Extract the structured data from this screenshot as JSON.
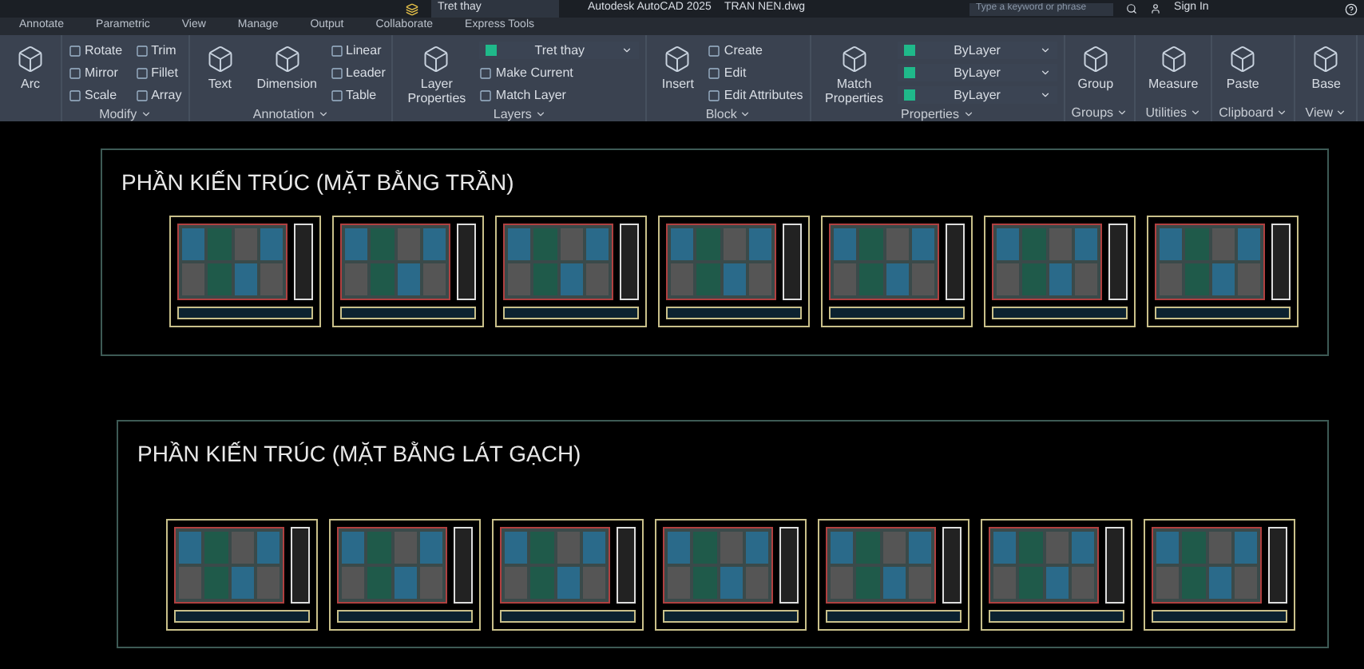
{
  "title_bar": {
    "layer": "Tret thay",
    "app_title": "Autodesk AutoCAD 2025",
    "file_name": "TRAN NEN.dwg",
    "search": {
      "placeholder": "Type a keyword or phrase"
    },
    "sign_in": "Sign In"
  },
  "ribbon_tabs": [
    {
      "label": "Annotate",
      "selected": false
    },
    {
      "label": "Parametric",
      "selected": false
    },
    {
      "label": "View",
      "selected": false
    },
    {
      "label": "Manage",
      "selected": false
    },
    {
      "label": "Output",
      "selected": false
    },
    {
      "label": "Collaborate",
      "selected": false
    },
    {
      "label": "Express Tools",
      "selected": false
    }
  ],
  "panels": [
    {
      "tools": [
        {
          "kind": "large",
          "label": "Arc"
        }
      ]
    },
    {
      "title": "Modify",
      "tools": [
        {
          "kind": "small",
          "label": "Rotate"
        },
        {
          "kind": "small",
          "label": "Mirror"
        },
        {
          "kind": "small",
          "label": "Scale"
        },
        {
          "kind": "small",
          "label": "Trim"
        },
        {
          "kind": "small",
          "label": "Fillet"
        },
        {
          "kind": "small",
          "label": "Array"
        }
      ]
    },
    {
      "title": "Annotation",
      "tools": [
        {
          "kind": "large",
          "label": "Text"
        },
        {
          "kind": "large",
          "label": "Dimension"
        },
        {
          "kind": "small",
          "label": "Linear"
        },
        {
          "kind": "small",
          "label": "Leader"
        },
        {
          "kind": "small",
          "label": "Table"
        }
      ]
    },
    {
      "title": "Layers",
      "tools": [
        {
          "kind": "large",
          "label": "Layer Properties"
        },
        {
          "kind": "dropdown",
          "label": "Tret thay"
        },
        {
          "kind": "small",
          "label": "Make Current"
        },
        {
          "kind": "small",
          "label": "Match Layer"
        }
      ]
    },
    {
      "title": "Block",
      "tools": [
        {
          "kind": "large",
          "label": "Insert"
        },
        {
          "kind": "small",
          "label": "Create"
        },
        {
          "kind": "small",
          "label": "Edit"
        },
        {
          "kind": "small",
          "label": "Edit Attributes"
        }
      ]
    },
    {
      "title": "Properties",
      "tools": [
        {
          "kind": "large",
          "label": "Match Properties"
        },
        {
          "kind": "dropdown",
          "label": "ByLayer"
        },
        {
          "kind": "dropdown",
          "label": "ByLayer"
        },
        {
          "kind": "dropdown",
          "label": "ByLayer"
        }
      ]
    },
    {
      "title": "Groups",
      "tools": [
        {
          "kind": "large",
          "label": "Group"
        }
      ]
    },
    {
      "title": "Utilities",
      "tools": [
        {
          "kind": "large",
          "label": "Measure"
        }
      ]
    },
    {
      "title": "Clipboard",
      "tools": [
        {
          "kind": "large",
          "label": "Paste"
        }
      ]
    },
    {
      "title": "View",
      "tools": [
        {
          "kind": "large",
          "label": "Base"
        }
      ]
    }
  ],
  "canvas_sections": [
    {
      "title": "PHẦN KIẾN TRÚC (MẶT BẰNG TRẦN)"
    },
    {
      "title": "PHẦN KIẾN TRÚC (MẶT BẰNG LÁT GẠCH)"
    }
  ]
}
